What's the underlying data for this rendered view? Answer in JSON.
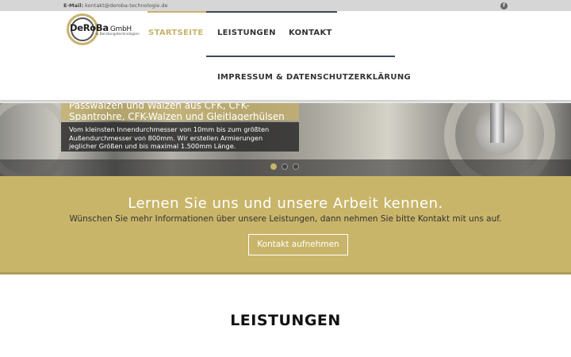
{
  "topbar": {
    "email_label": "E-Mail:",
    "email_value": "kontakt@deroba-technologie.de",
    "facebook_glyph": "f"
  },
  "logo": {
    "brand": "DeRoBa",
    "suffix": "GmbH",
    "tagline": "& Beratungstechnologien"
  },
  "nav": {
    "items": [
      {
        "label": "STARTSEITE",
        "active": true
      },
      {
        "label": "LEISTUNGEN",
        "active": false
      },
      {
        "label": "KONTAKT",
        "active": false
      },
      {
        "label": "IMPRESSUM & DATENSCHUTZERKLÄRUNG",
        "active": false
      }
    ]
  },
  "hero": {
    "headline": "Passwalzen und Walzen aus CFK, CFK-Spantrohre, CFK-Walzen und Gleitlagerhülsen",
    "description": "Vom kleinsten Innendurchmesser von 10mm bis zum größten Außendurchmesser von 800mm. Wir erstellen Armierungen jeglicher Größen und bis maximal 1.500mm Länge.",
    "slides": 3,
    "active_slide": 1
  },
  "cta": {
    "heading": "Lernen Sie uns und unsere Arbeit kennen.",
    "text": "Wünschen Sie mehr Informationen über unsere Leistungen, dann nehmen Sie bitte Kontakt mit uns auf.",
    "button": "Kontakt aufnehmen"
  },
  "section": {
    "title": "LEISTUNGEN"
  },
  "colors": {
    "accent": "#c7b36a",
    "nav_line": "#3a4b57",
    "topbar": "#d6d6d6"
  }
}
